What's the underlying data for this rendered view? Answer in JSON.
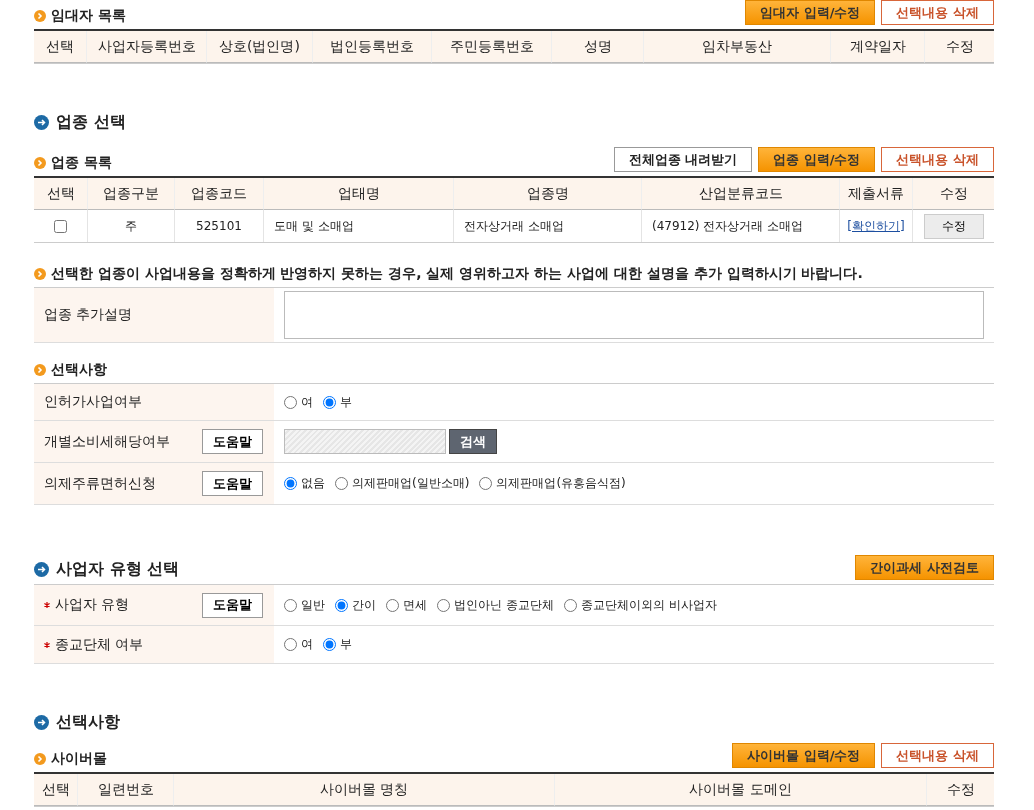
{
  "lessor_list": {
    "title": "임대자 목록",
    "buttons": [
      {
        "label": "임대자 입력/수정",
        "kind": "primary"
      },
      {
        "label": "선택내용 삭제",
        "kind": "outline"
      }
    ],
    "columns": [
      "선택",
      "사업자등록번호",
      "상호(법인명)",
      "법인등록번호",
      "주민등록번호",
      "성명",
      "임차부동산",
      "계약일자",
      "수정"
    ]
  },
  "industry_section": {
    "title": "업종 선택",
    "list_title": "업종 목록",
    "buttons": [
      {
        "label": "전체업종 내려받기",
        "kind": "plain"
      },
      {
        "label": "업종 입력/수정",
        "kind": "primary"
      },
      {
        "label": "선택내용 삭제",
        "kind": "outline"
      }
    ],
    "columns": [
      "선택",
      "업종구분",
      "업종코드",
      "업태명",
      "업종명",
      "산업분류코드",
      "제출서류",
      "수정"
    ],
    "rows": [
      {
        "checked": false,
        "division": "주",
        "code": "525101",
        "business_type": "도매 및 소매업",
        "industry_name": "전자상거래 소매업",
        "classification": "(47912) 전자상거래 소매업",
        "documents_link": "[확인하기]",
        "edit_button": "수정"
      }
    ],
    "notice": "선택한 업종이 사업내용을 정확하게 반영하지 못하는 경우, 실제 영위하고자 하는 사업에 대한 설명을 추가 입력하시기 바랍니다.",
    "extra_description": {
      "label": "업종 추가설명"
    }
  },
  "options": {
    "title": "선택사항",
    "rows": [
      {
        "label": "인허가사업여부",
        "kind": "radio",
        "options": [
          {
            "label": "여",
            "selected": false
          },
          {
            "label": "부",
            "selected": true
          }
        ]
      },
      {
        "label": "개별소비세해당여부",
        "help_button": "도움말",
        "kind": "search",
        "search_button": "검색"
      },
      {
        "label": "의제주류면허신청",
        "help_button": "도움말",
        "kind": "radio",
        "options": [
          {
            "label": "없음",
            "selected": true
          },
          {
            "label": "의제판매업(일반소매)",
            "selected": false
          },
          {
            "label": "의제판매업(유흥음식점)",
            "selected": false
          }
        ]
      }
    ]
  },
  "business_type": {
    "title": "사업자 유형 선택",
    "button": "간이과세 사전검토",
    "rows": [
      {
        "label": "사업자 유형",
        "required": true,
        "help_button": "도움말",
        "kind": "radio",
        "options": [
          {
            "label": "일반",
            "selected": false
          },
          {
            "label": "간이",
            "selected": true
          },
          {
            "label": "면세",
            "selected": false
          },
          {
            "label": "법인아닌 종교단체",
            "selected": false
          },
          {
            "label": "종교단체이외의 비사업자",
            "selected": false
          }
        ]
      },
      {
        "label": "종교단체 여부",
        "required": true,
        "kind": "radio",
        "options": [
          {
            "label": "여",
            "selected": false
          },
          {
            "label": "부",
            "selected": true
          }
        ]
      }
    ]
  },
  "optional_section": {
    "title": "선택사항",
    "cyber_mall": {
      "title": "사이버몰",
      "buttons": [
        {
          "label": "사이버몰 입력/수정",
          "kind": "primary"
        },
        {
          "label": "선택내용 삭제",
          "kind": "outline"
        }
      ],
      "columns": [
        "선택",
        "일련번호",
        "사이버몰 명칭",
        "사이버몰 도메인",
        "수정"
      ]
    }
  }
}
